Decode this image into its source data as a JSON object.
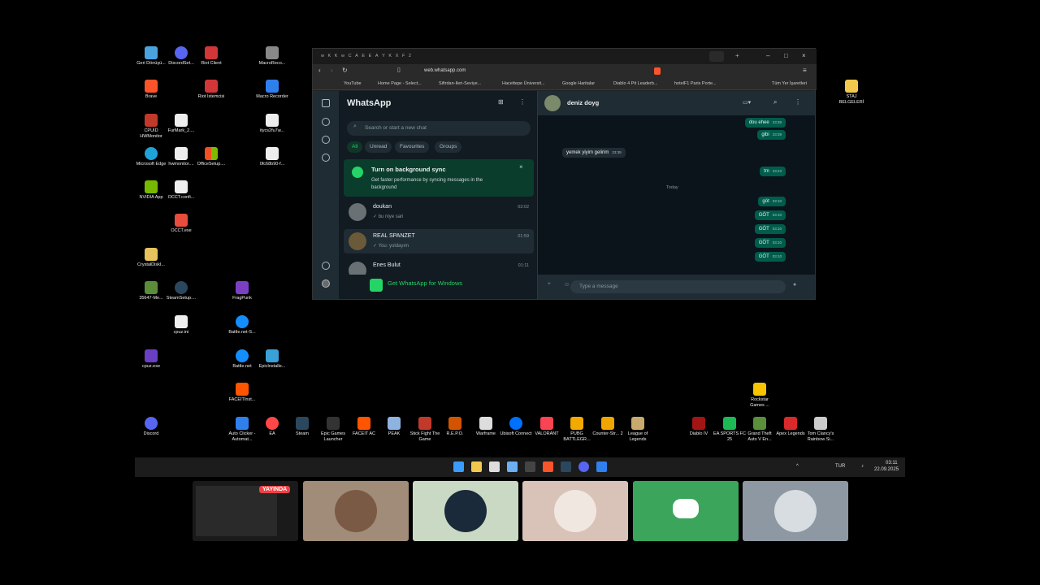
{
  "desktop_icons": [
    {
      "label": "Geri Dönüşü...",
      "color": "#4aa3df"
    },
    {
      "label": "DiscordSet...",
      "color": "#5865f2"
    },
    {
      "label": "Riot Client",
      "color": "#d13639"
    },
    {
      "label": "MacroReco...",
      "color": "#888888"
    },
    {
      "label": "Brave",
      "color": "#fb542b"
    },
    {
      "label": "Riot İstemcisi",
      "color": "#d13639"
    },
    {
      "label": "Macro Recorder",
      "color": "#2f80ed"
    },
    {
      "label": "CPUID HWMonitor",
      "color": "#c0392b"
    },
    {
      "label": "FurMark_2....",
      "color": "#eeeeee"
    },
    {
      "label": "itycs2fu7w...",
      "color": "#eeeeee"
    },
    {
      "label": "Microsoft Edge",
      "color": "#1fa3d6"
    },
    {
      "label": "hwmonitor....",
      "color": "#eeeeee"
    },
    {
      "label": "OfficeSetup....",
      "color": "#f25022"
    },
    {
      "label": "0fc68b90-f...",
      "color": "#eeeeee"
    },
    {
      "label": "NVIDIA App",
      "color": "#76b900"
    },
    {
      "label": "OCCT.confi...",
      "color": "#eeeeee"
    },
    {
      "label": "OCCT.exe",
      "color": "#e74c3c"
    },
    {
      "label": "CrystalDiskI...",
      "color": "#e6c35c"
    },
    {
      "label": "35647-Me...",
      "color": "#5b8c3a"
    },
    {
      "label": "SteamSetup....",
      "color": "#2a475e"
    },
    {
      "label": "FragPunk",
      "color": "#7b3fc4"
    },
    {
      "label": "cpuz.ini",
      "color": "#eeeeee"
    },
    {
      "label": "Battle.net-S...",
      "color": "#148eff"
    },
    {
      "label": "cpuz.exe",
      "color": "#6a3fc4"
    },
    {
      "label": "Battle.net",
      "color": "#148eff"
    },
    {
      "label": "EpicInstalle...",
      "color": "#3aa0d8"
    },
    {
      "label": "FACEITInst...",
      "color": "#ff5500"
    },
    {
      "label": "Rockstar Games ...",
      "color": "#f6c400"
    },
    {
      "label": "STAJ BELGELERİ",
      "color": "#f2c94c"
    }
  ],
  "desktop_row_icons": [
    {
      "label": "Discord",
      "color": "#5865f2"
    },
    {
      "label": "Auto Clicker - Automat...",
      "color": "#2f80ed"
    },
    {
      "label": "EA",
      "color": "#ff4747"
    },
    {
      "label": "Steam",
      "color": "#2a475e"
    },
    {
      "label": "Epic Games Launcher",
      "color": "#333333"
    },
    {
      "label": "FACEIT AC",
      "color": "#ff5500"
    },
    {
      "label": "PEAK",
      "color": "#8fb3e0"
    },
    {
      "label": "Stick Fight The Game",
      "color": "#c0392b"
    },
    {
      "label": "R.E.P.O.",
      "color": "#d35400"
    },
    {
      "label": "Warframe",
      "color": "#dddddd"
    },
    {
      "label": "Ubisoft Connect",
      "color": "#0070ff"
    },
    {
      "label": "VALORANT",
      "color": "#fa4454"
    },
    {
      "label": "PUBG BATTLEGR...",
      "color": "#f2a900"
    },
    {
      "label": "Counter-Str... 2",
      "color": "#f0a500"
    },
    {
      "label": "League of Legends",
      "color": "#c8aa6e"
    },
    {
      "label": "Diablo IV",
      "color": "#a31515"
    },
    {
      "label": "EA SPORTS FC 25",
      "color": "#1db954"
    },
    {
      "label": "Grand Theft Auto V En...",
      "color": "#5a8f3c"
    },
    {
      "label": "Apex Legends",
      "color": "#da292a"
    },
    {
      "label": "Tom Clancy's Rainbow Si...",
      "color": "#cccccc"
    }
  ],
  "taskbar": {
    "lang": "TUR",
    "time": "03:11",
    "date": "22.09.2025"
  },
  "browser": {
    "url": "web.whatsapp.com",
    "bookmarks": [
      "YouTube",
      "Home Page - Select...",
      "Sifirdan-Ileri-Seviye...",
      "Hacettepe Üniversit...",
      "Google Haritalar",
      "Diablo 4 Pit Leaderb...",
      "hotelF1 Paris Porte...",
      "Tüm Yer İşaretleri"
    ]
  },
  "whatsapp": {
    "title": "WhatsApp",
    "search_placeholder": "Search or start a new chat",
    "filters": [
      "All",
      "Unread",
      "Favourites",
      "Groups"
    ],
    "sync_title": "Turn on background sync",
    "sync_desc": "Get faster performance by syncing messages in the background",
    "chats": [
      {
        "name": "doukan",
        "preview": "✓ bu niye sari",
        "time": "03:02"
      },
      {
        "name": "REAL SPANZET",
        "preview": "✓ You: yoldayım",
        "time": "01:59"
      },
      {
        "name": "Enes Bulut",
        "preview": "",
        "time": "01:11"
      }
    ],
    "get_app": "Get WhatsApp for Windows",
    "contact": "deniz doyg",
    "messages": [
      {
        "text": "dou ehee",
        "time": "23:39",
        "dir": "out"
      },
      {
        "text": "gibi",
        "time": "23:39",
        "dir": "out"
      },
      {
        "text": "yemek yiyim gelirim",
        "time": "23:39",
        "dir": "in"
      },
      {
        "text": "tm",
        "time": "23:43",
        "dir": "out"
      },
      {
        "text": "göt",
        "time": "03:10",
        "dir": "out"
      },
      {
        "text": "GÖT",
        "time": "03:10",
        "dir": "out"
      },
      {
        "text": "GÖT",
        "time": "03:10",
        "dir": "out"
      },
      {
        "text": "GÖT",
        "time": "03:10",
        "dir": "out"
      },
      {
        "text": "GÖT",
        "time": "03:10",
        "dir": "out"
      }
    ],
    "day_divider": "Today",
    "input_placeholder": "Type a message"
  },
  "call": {
    "live_label": "YAYINDA",
    "tile_colors": [
      "#1a1a1a",
      "#a08c78",
      "#c9d9c4",
      "#d9c2b8",
      "#3ba55c",
      "#8e98a3"
    ]
  }
}
